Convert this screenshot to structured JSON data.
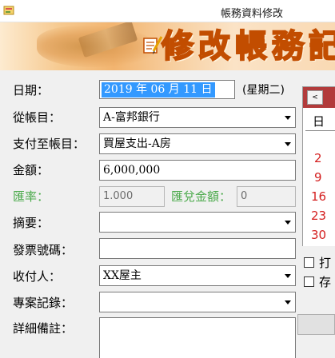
{
  "window": {
    "title": "帳務資料修改"
  },
  "banner": {
    "title": "修改帳務記錄"
  },
  "form": {
    "date_label": "日期：",
    "date_value": "2019 年 06 月 11 日",
    "weekday": "(星期二)",
    "from_account_label": "從帳目：",
    "from_account_value": "A-富邦銀行",
    "to_account_label": "支付至帳目：",
    "to_account_value": "買屋支出-A房",
    "amount_label": "金額：",
    "amount_value": "6,000,000",
    "rate_label": "匯率：",
    "rate_value": "1.000",
    "exchanged_label": "匯兌金額：",
    "exchanged_value": "0",
    "summary_label": "摘要：",
    "summary_value": "",
    "invoice_label": "發票號碼：",
    "invoice_value": "",
    "payee_label": "收付人：",
    "payee_value": "XX屋主",
    "project_label": "專案記錄：",
    "project_value": "",
    "notes_label": "詳細備註：",
    "notes_value": ""
  },
  "calendar": {
    "prev_label": "<",
    "day_of_week_header": "日",
    "visible_days": [
      "2",
      "9",
      "16",
      "23",
      "30"
    ],
    "day_color": "#d41f1f",
    "header_color": "#b23b3b"
  },
  "options": {
    "checkbox1_label": "打",
    "checkbox2_label": "存"
  },
  "colors": {
    "selection": "#3399ff",
    "disabled_label": "#4caa4c",
    "banner_title": "#f07c1a"
  }
}
